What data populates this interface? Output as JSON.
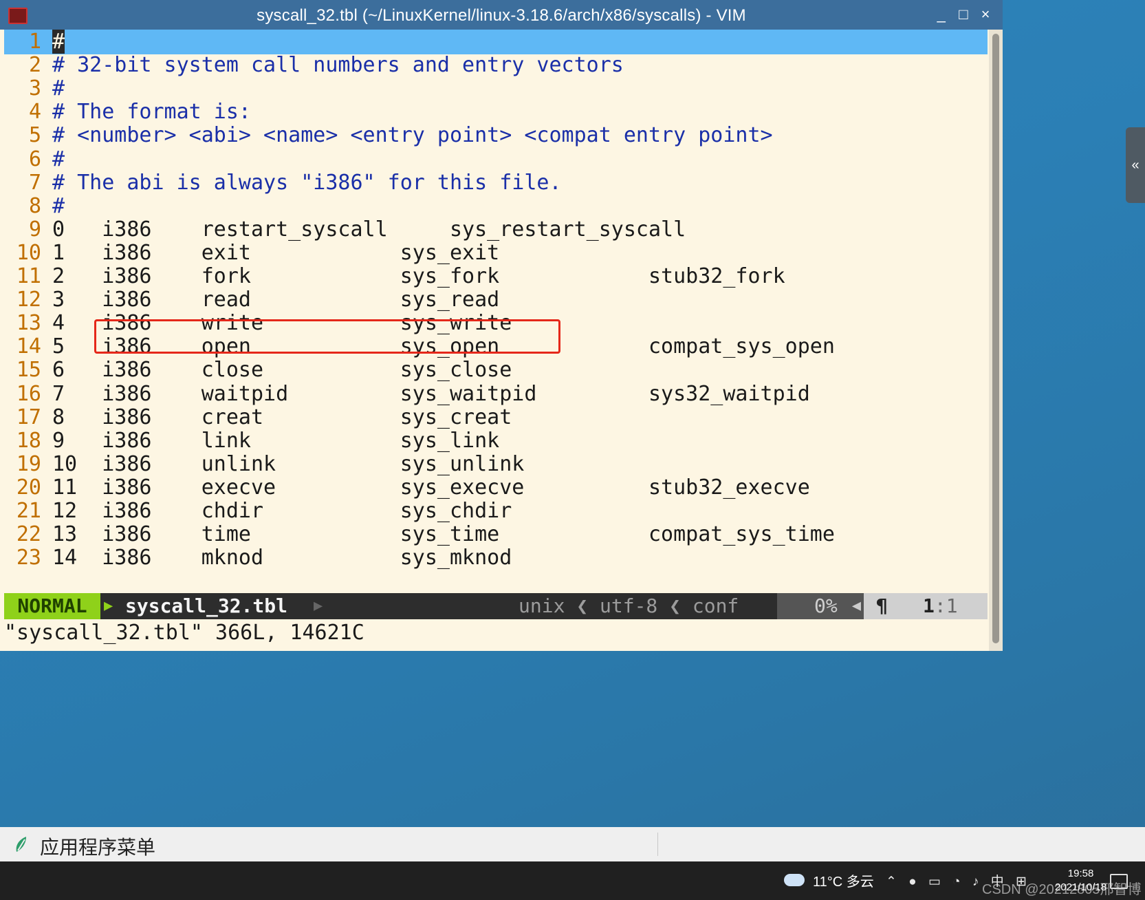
{
  "window": {
    "title": "syscall_32.tbl (~/LinuxKernel/linux-3.18.6/arch/x86/syscalls) - VIM",
    "buttons": {
      "minimize": "_",
      "maximize": "□",
      "close": "×"
    }
  },
  "editor": {
    "lines": [
      {
        "num": "1",
        "text": "#",
        "kind": "comment"
      },
      {
        "num": "2",
        "text": "# 32-bit system call numbers and entry vectors",
        "kind": "comment"
      },
      {
        "num": "3",
        "text": "#",
        "kind": "comment"
      },
      {
        "num": "4",
        "text": "# The format is:",
        "kind": "comment"
      },
      {
        "num": "5",
        "text": "# <number> <abi> <name> <entry point> <compat entry point>",
        "kind": "comment"
      },
      {
        "num": "6",
        "text": "#",
        "kind": "comment"
      },
      {
        "num": "7",
        "text": "# The abi is always \"i386\" for this file.",
        "kind": "comment"
      },
      {
        "num": "8",
        "text": "#",
        "kind": "comment"
      },
      {
        "num": "9",
        "text": "0   i386    restart_syscall     sys_restart_syscall",
        "kind": "code"
      },
      {
        "num": "10",
        "text": "1   i386    exit            sys_exit",
        "kind": "code"
      },
      {
        "num": "11",
        "text": "2   i386    fork            sys_fork            stub32_fork",
        "kind": "code"
      },
      {
        "num": "12",
        "text": "3   i386    read            sys_read",
        "kind": "code"
      },
      {
        "num": "13",
        "text": "4   i386    write           sys_write",
        "kind": "code"
      },
      {
        "num": "14",
        "text": "5   i386    open            sys_open            compat_sys_open",
        "kind": "code"
      },
      {
        "num": "15",
        "text": "6   i386    close           sys_close",
        "kind": "code"
      },
      {
        "num": "16",
        "text": "7   i386    waitpid         sys_waitpid         sys32_waitpid",
        "kind": "code"
      },
      {
        "num": "17",
        "text": "8   i386    creat           sys_creat",
        "kind": "code"
      },
      {
        "num": "18",
        "text": "9   i386    link            sys_link",
        "kind": "code"
      },
      {
        "num": "19",
        "text": "10  i386    unlink          sys_unlink",
        "kind": "code"
      },
      {
        "num": "20",
        "text": "11  i386    execve          sys_execve          stub32_execve",
        "kind": "code"
      },
      {
        "num": "21",
        "text": "12  i386    chdir           sys_chdir",
        "kind": "code"
      },
      {
        "num": "22",
        "text": "13  i386    time            sys_time            compat_sys_time",
        "kind": "code"
      },
      {
        "num": "23",
        "text": "14  i386    mknod           sys_mknod",
        "kind": "code"
      }
    ]
  },
  "statusline": {
    "mode": "NORMAL",
    "filename": "syscall_32.tbl",
    "fileinfo": "unix ❮ utf-8 ❮ conf",
    "percent": "0%",
    "pos_line": "1",
    "pos_col": ":1"
  },
  "cmdline": "\"syscall_32.tbl\" 366L, 14621C",
  "sidetab": "«",
  "panel": {
    "menu_label": "应用程序菜单"
  },
  "taskbar": {
    "weather": "11°C 多云",
    "time": "19:58",
    "date": "2021/10/18",
    "watermark": "CSDN @20212805邢智博"
  },
  "colors": {
    "editor_bg": "#fdf6e3",
    "comment": "#1a2fa8",
    "line_number": "#c06f00",
    "current_line": "#5fb8f5",
    "mode_bg": "#8fd11a",
    "highlight_box": "#e5281a"
  }
}
